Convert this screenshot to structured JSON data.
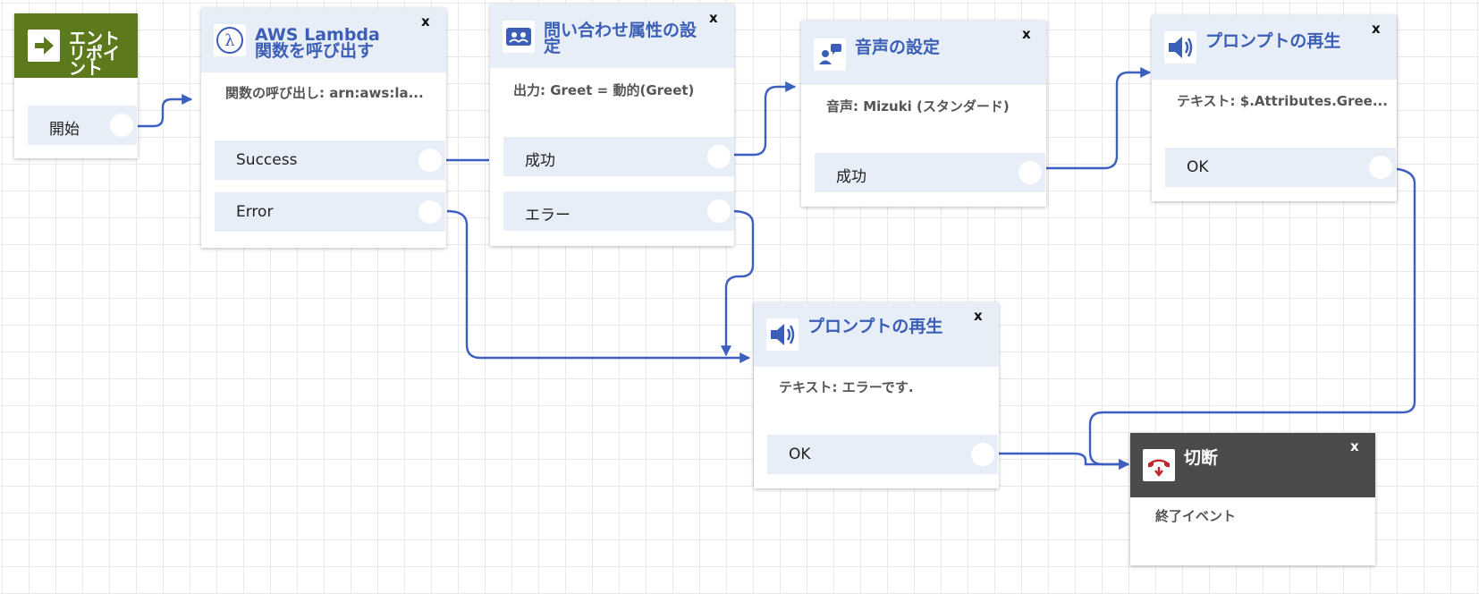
{
  "colors": {
    "accent": "#3b5fb6",
    "header_bg": "#e8eef7",
    "entry_bg": "#5c7a1c",
    "disconnect_bg": "#4a4a4a",
    "connector": "#3d5fbf"
  },
  "close_label": "x",
  "blocks": {
    "entry": {
      "icon": "arrow-right-icon",
      "title": "エント\nリポイ\nント",
      "branches": [
        "開始"
      ]
    },
    "lambda": {
      "icon": "lambda-icon",
      "title": "AWS Lambda\n関数を呼び出す",
      "desc": "関数の呼び出し: arn:aws:la...",
      "branches": [
        "Success",
        "Error"
      ]
    },
    "setattr": {
      "icon": "contact-attributes-icon",
      "title": "問い合わせ属性の設\n定",
      "desc": "出力: Greet = 動的(Greet)",
      "branches": [
        "成功",
        "エラー"
      ]
    },
    "voice": {
      "icon": "voice-settings-icon",
      "title": "音声の設定",
      "desc": "音声: Mizuki (スタンダード)",
      "branches": [
        "成功"
      ]
    },
    "prompt1": {
      "icon": "speaker-icon",
      "title": "プロンプトの再生",
      "desc": "テキスト: $.Attributes.Gree...",
      "branches": [
        "OK"
      ]
    },
    "prompt2": {
      "icon": "speaker-icon",
      "title": "プロンプトの再生",
      "desc": "テキスト: エラーです.",
      "branches": [
        "OK"
      ]
    },
    "disconnect": {
      "icon": "hang-up-phone-icon",
      "title": "切断",
      "desc": "終了イベント"
    }
  }
}
